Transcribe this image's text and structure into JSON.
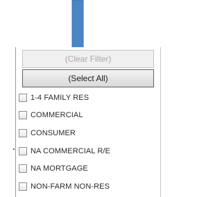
{
  "filter_menu": {
    "clear_filter_label": "(Clear Filter)",
    "select_all_label": "(Select All)",
    "items": [
      {
        "label": "1-4 FAMILY RES",
        "checked": false
      },
      {
        "label": "COMMERCIAL",
        "checked": false
      },
      {
        "label": "CONSUMER",
        "checked": false
      },
      {
        "label": "NA COMMERCIAL R/E",
        "checked": false
      },
      {
        "label": "NA MORTGAGE",
        "checked": false
      },
      {
        "label": "NON-FARM NON-RES",
        "checked": false
      }
    ]
  },
  "colors": {
    "arrow": "#4a86c5",
    "arrow_outline": "#3a6fa8"
  },
  "icons": {
    "pointer": "down-arrow-icon",
    "checkbox": "checkbox-icon"
  }
}
